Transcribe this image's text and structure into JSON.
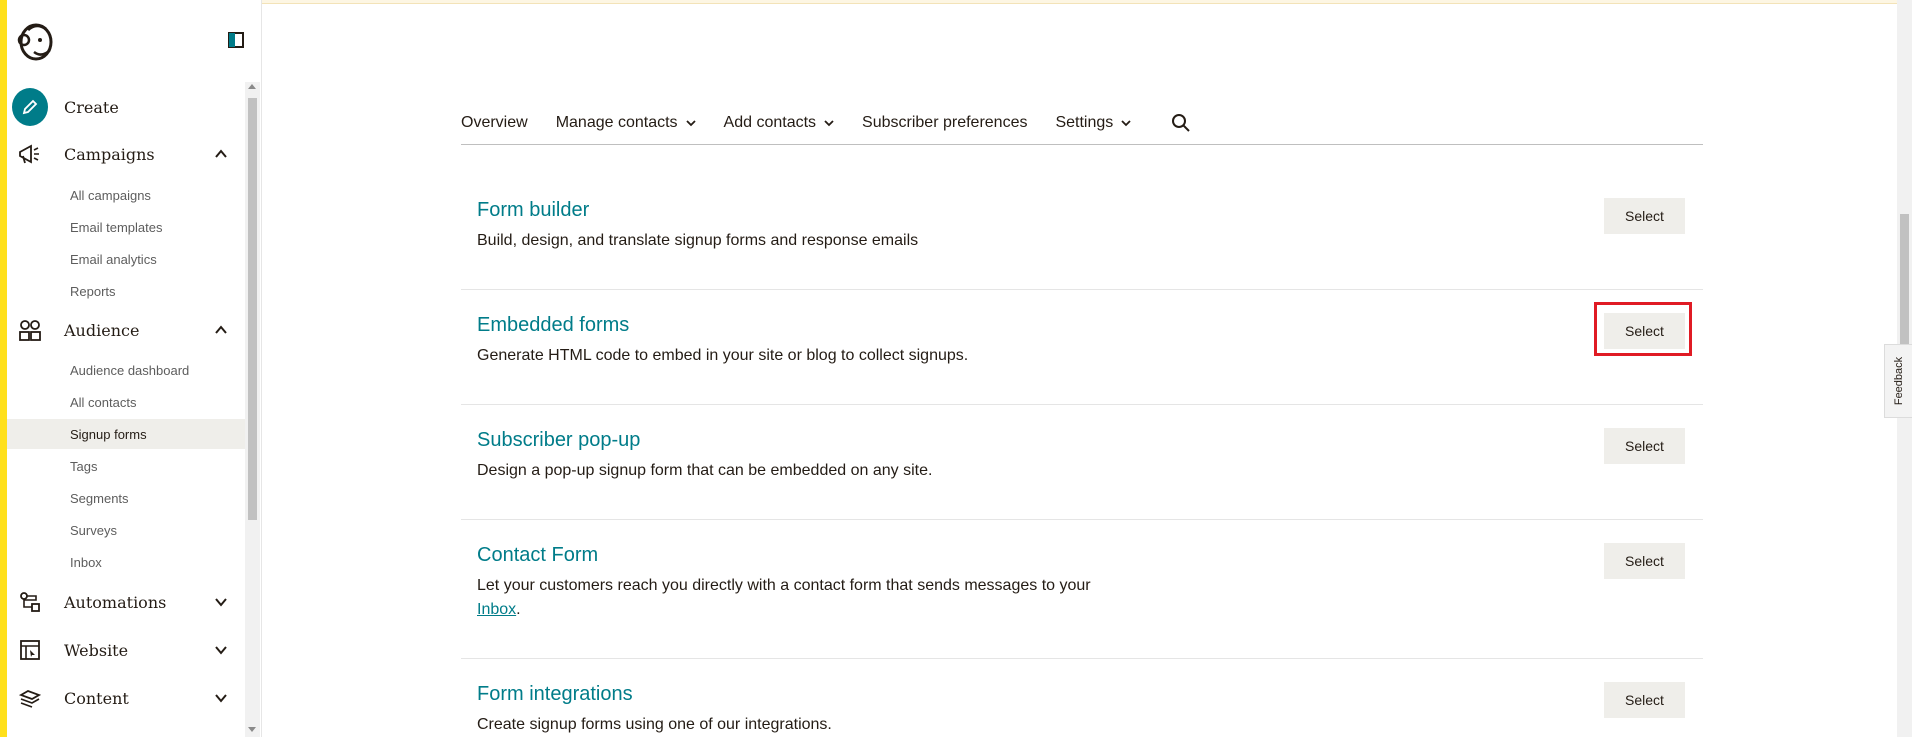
{
  "sidebar": {
    "create_label": "Create",
    "campaigns": {
      "label": "Campaigns",
      "items": [
        "All campaigns",
        "Email templates",
        "Email analytics",
        "Reports"
      ]
    },
    "audience": {
      "label": "Audience",
      "items": [
        "Audience dashboard",
        "All contacts",
        "Signup forms",
        "Tags",
        "Segments",
        "Surveys",
        "Inbox"
      ],
      "active": "Signup forms"
    },
    "automations_label": "Automations",
    "website_label": "Website",
    "content_label": "Content"
  },
  "tabs": [
    {
      "label": "Overview"
    },
    {
      "label": "Manage contacts"
    },
    {
      "label": "Add contacts"
    },
    {
      "label": "Subscriber preferences"
    },
    {
      "label": "Settings"
    }
  ],
  "forms": [
    {
      "title": "Form builder",
      "description": "Build, design, and translate signup forms and response emails",
      "button": "Select"
    },
    {
      "title": "Embedded forms",
      "description": "Generate HTML code to embed in your site or blog to collect signups.",
      "button": "Select"
    },
    {
      "title": "Subscriber pop-up",
      "description": "Design a pop-up signup form that can be embedded on any site.",
      "button": "Select"
    },
    {
      "title": "Contact Form",
      "description_prefix": "Let your customers reach you directly with a contact form that sends messages to your ",
      "description_link": "Inbox",
      "description_suffix": ".",
      "button": "Select"
    },
    {
      "title": "Form integrations",
      "description": "Create signup forms using one of our integrations.",
      "button": "Select"
    }
  ],
  "feedback_label": "Feedback",
  "colors": {
    "accent": "#007c89",
    "brand_yellow": "#ffe01b",
    "highlight": "#e01b24"
  }
}
